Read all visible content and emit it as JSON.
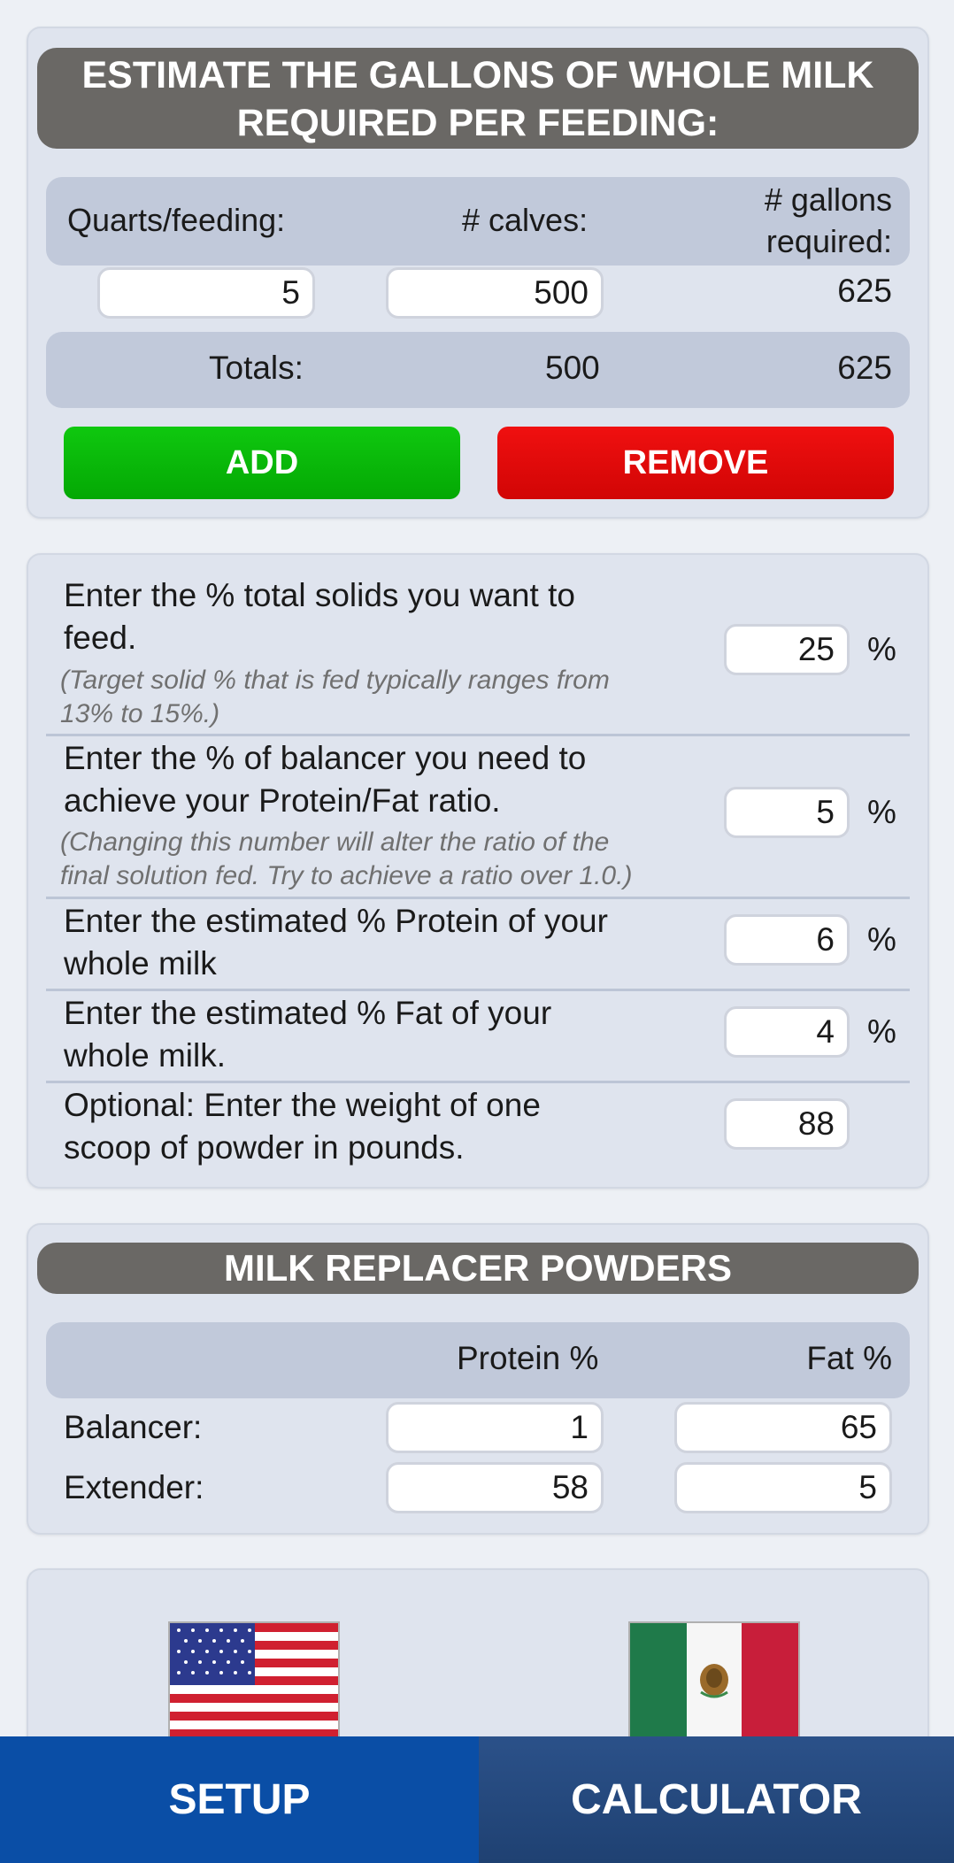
{
  "gallons_card": {
    "title_line1": "ESTIMATE THE GALLONS OF WHOLE MILK",
    "title_line2": "REQUIRED PER FEEDING:",
    "col_quarts": "Quarts/feeding:",
    "col_calves": "# calves:",
    "col_gallons_line1": "# gallons",
    "col_gallons_line2": "required:",
    "row": {
      "quarts": "5",
      "calves": "500",
      "gallons": "625"
    },
    "totals_label": "Totals:",
    "totals_calves": "500",
    "totals_gallons": "625",
    "add_label": "ADD",
    "remove_label": "REMOVE"
  },
  "solids_card": {
    "solids_line1": "Enter the % total solids you want to",
    "solids_line2": "feed.",
    "solids_note_line1": "(Target solid % that is fed typically ranges from",
    "solids_note_line2": "13% to 15%.)",
    "solids_value": "25",
    "balancer_line1": "Enter the % of balancer you need to",
    "balancer_line2": "achieve your Protein/Fat ratio.",
    "balancer_note_line1": "(Changing this number will alter the ratio of the",
    "balancer_note_line2": "final solution fed. Try to achieve a ratio over 1.0.)",
    "balancer_value": "5",
    "protein_line1": "Enter the estimated % Protein of your",
    "protein_line2": "whole milk",
    "protein_value": "6",
    "fat_line1": "Enter the estimated % Fat of your",
    "fat_line2": "whole milk.",
    "fat_value": "4",
    "scoop_line1": "Optional: Enter the weight of one",
    "scoop_line2": "scoop of powder in pounds.",
    "scoop_value": "88",
    "percent_symbol": "%"
  },
  "powders_card": {
    "title": "MILK REPLACER POWDERS",
    "col_protein": "Protein %",
    "col_fat": "Fat %",
    "balancer_label": "Balancer:",
    "balancer_protein": "1",
    "balancer_fat": "65",
    "extender_label": "Extender:",
    "extender_protein": "58",
    "extender_fat": "5"
  },
  "language_card": {
    "flags": [
      "us-flag-icon",
      "mexico-flag-icon"
    ]
  },
  "nav": {
    "setup_label": "SETUP",
    "calculator_label": "CALCULATOR"
  },
  "colors": {
    "add_green": "#06b806",
    "remove_red": "#e30808",
    "header_gray": "#6a6865",
    "nav_active": "#0a4ea6",
    "nav_inactive": "#2a4c80"
  }
}
